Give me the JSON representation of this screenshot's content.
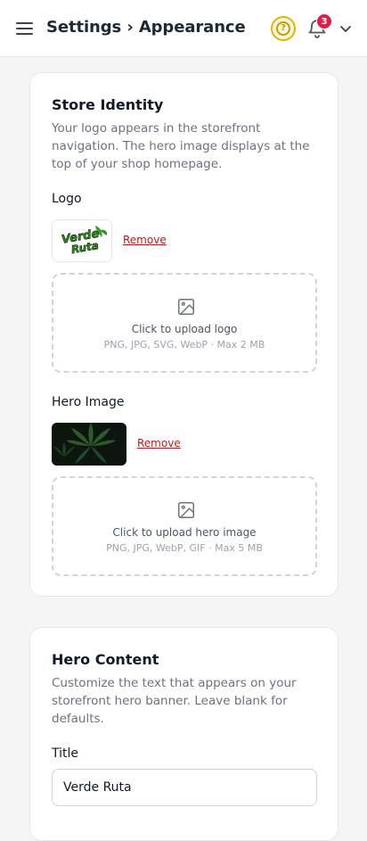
{
  "header": {
    "title": "Settings › Appearance",
    "notification_count": "3",
    "icons": {
      "menu": "hamburger-menu-icon",
      "help": "help-circle-icon",
      "bell": "bell-icon",
      "chevron": "chevron-down-icon"
    },
    "colors": {
      "help_accent": "#e3b308",
      "badge": "#e11d48"
    }
  },
  "store_identity": {
    "title": "Store Identity",
    "description": "Your logo appears in the storefront navigation. The hero image displays at the top of your shop homepage.",
    "logo": {
      "label": "Logo",
      "brand_text_line1": "Verde",
      "brand_text_line2": "Ruta",
      "remove_label": "Remove",
      "upload_label": "Click to upload logo",
      "upload_hint": "PNG, JPG, SVG, WebP · Max 2 MB"
    },
    "hero": {
      "label": "Hero Image",
      "remove_label": "Remove",
      "upload_label": "Click to upload hero image",
      "upload_hint": "PNG, JPG, WebP, GIF · Max 5 MB"
    }
  },
  "hero_content": {
    "title": "Hero Content",
    "description": "Customize the text that appears on your storefront hero banner. Leave blank for defaults.",
    "title_field": {
      "label": "Title",
      "value": "Verde Ruta"
    }
  },
  "colors": {
    "remove_link": "#b91c1c",
    "brand_green": "#2f8a1f"
  }
}
